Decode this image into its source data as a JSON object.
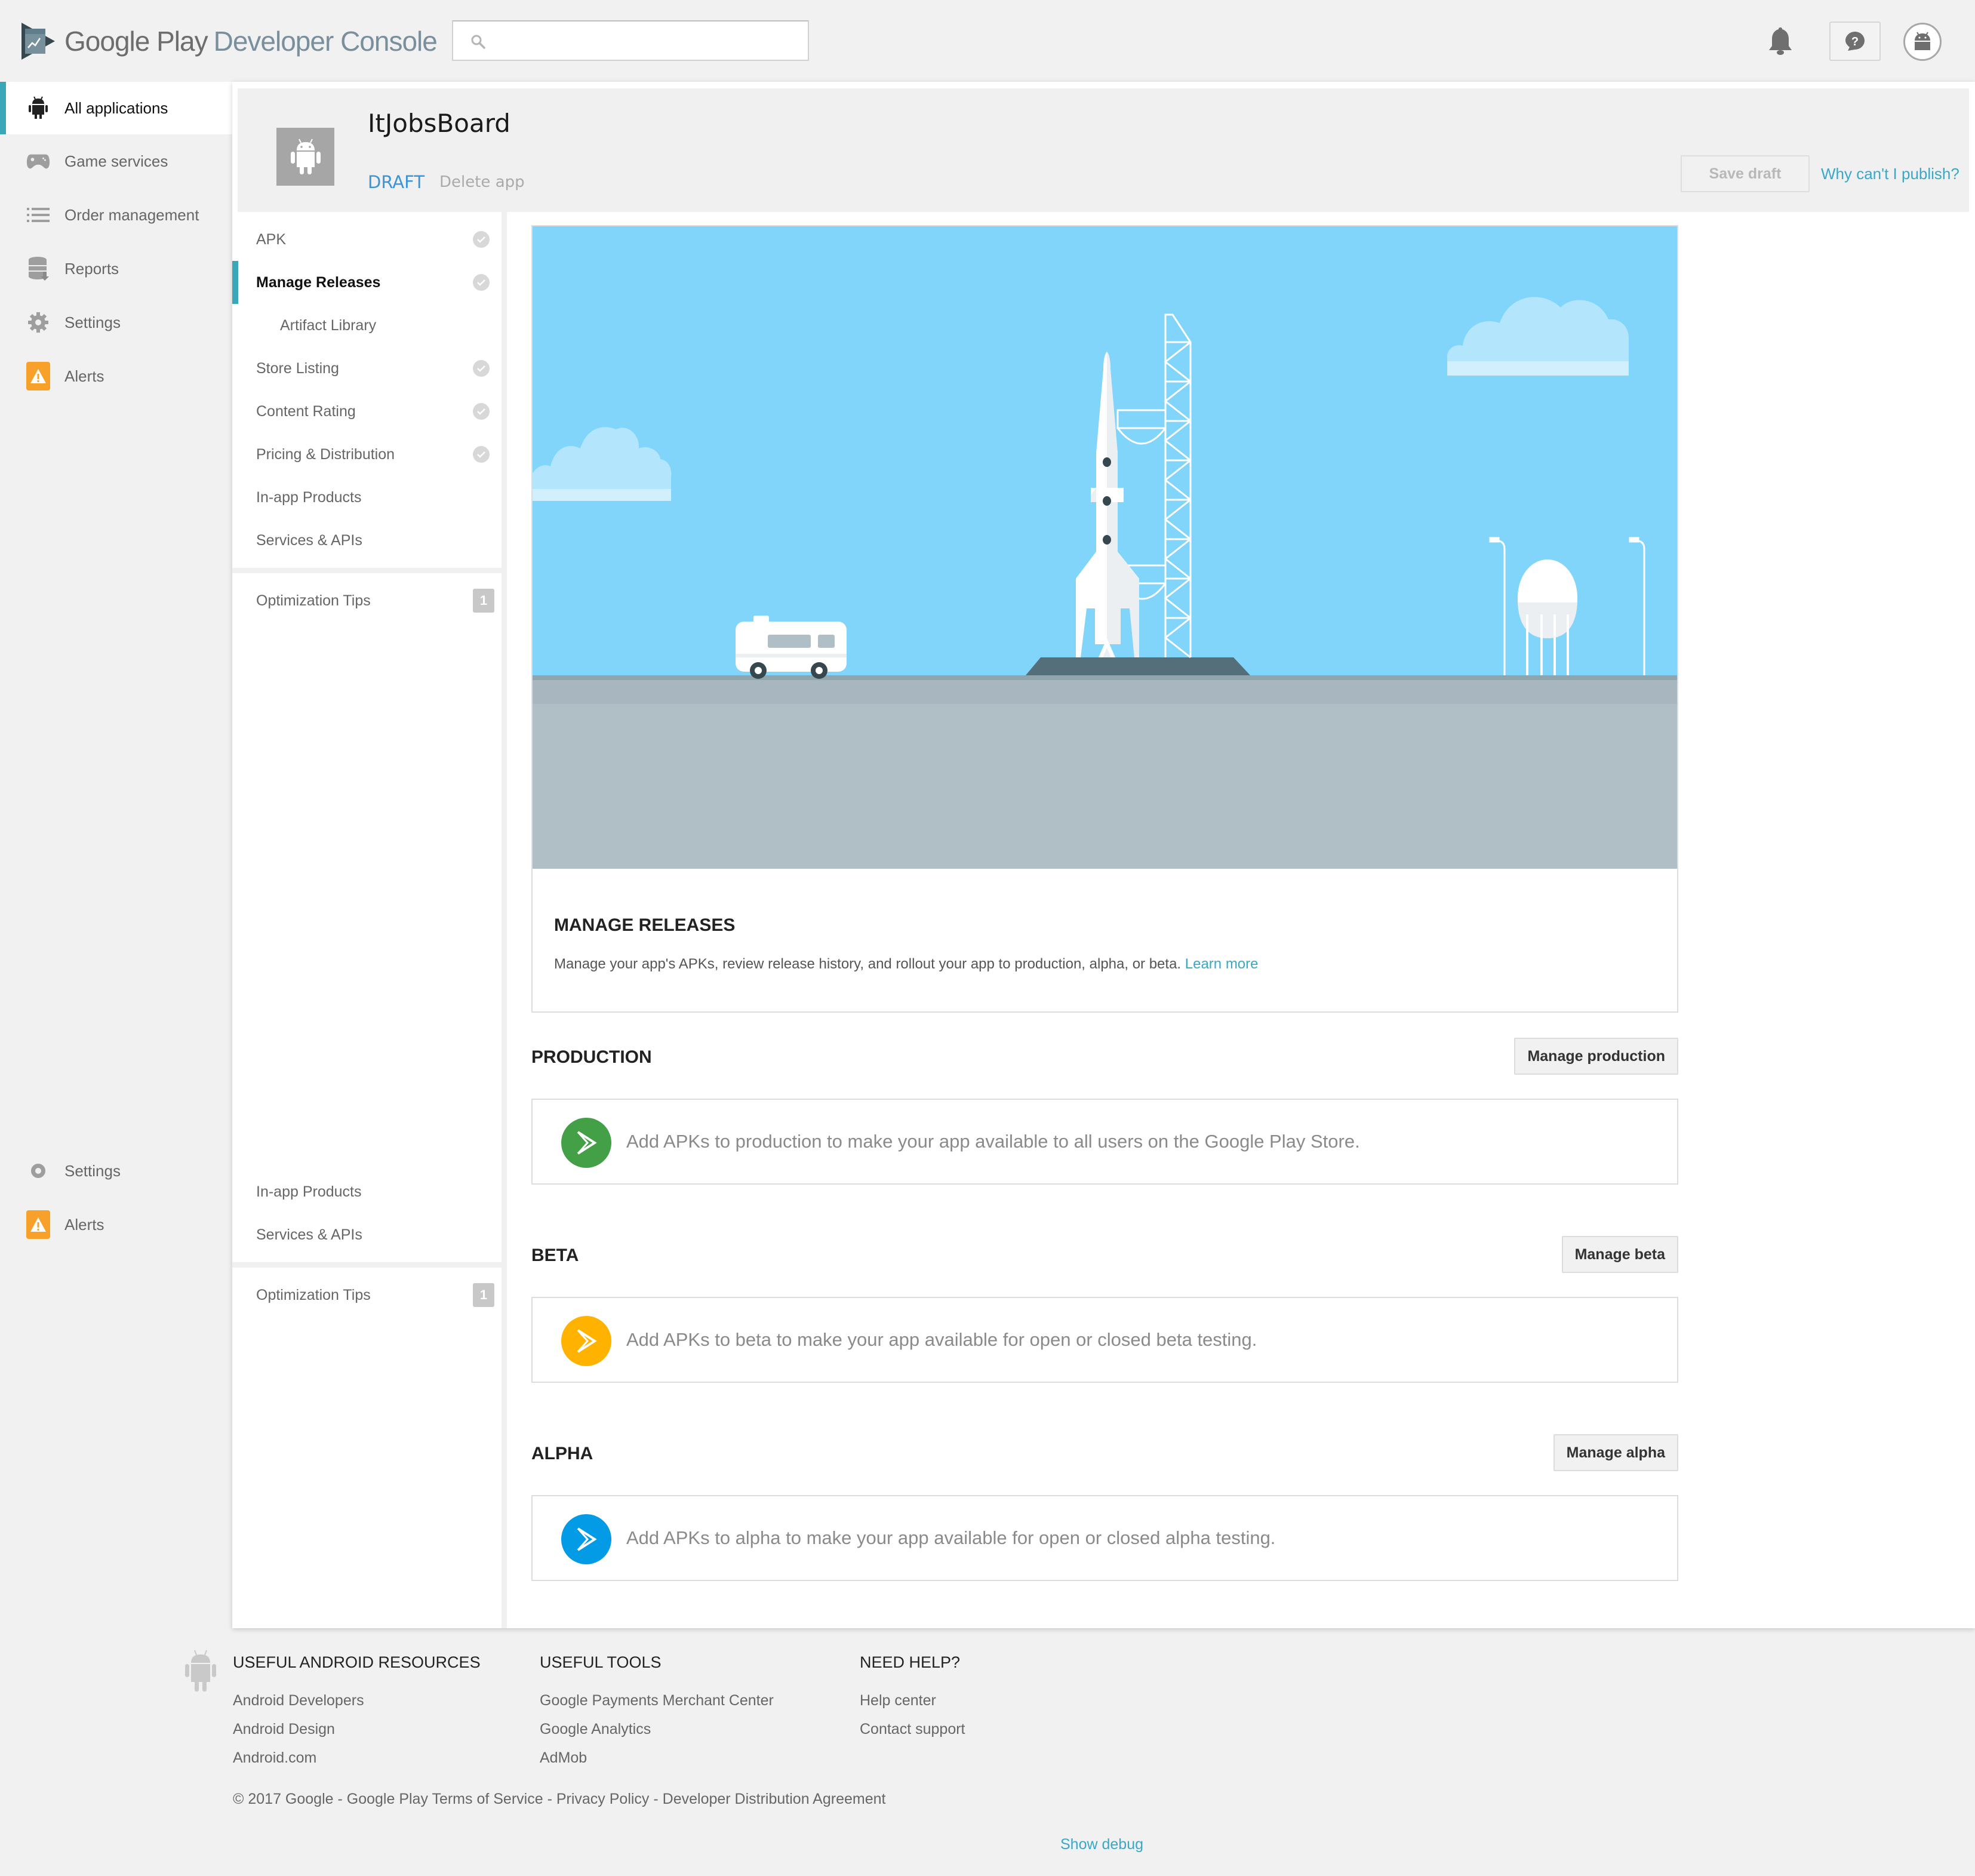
{
  "topbar": {
    "brand_primary": "Google Play",
    "brand_secondary": "Developer Console",
    "search_placeholder": "",
    "search_value": "",
    "icons": [
      "bell-icon",
      "help-icon",
      "android-avatar-icon"
    ]
  },
  "leftnav": {
    "items": [
      {
        "label": "All applications",
        "icon": "android-icon",
        "active": true
      },
      {
        "label": "Game services",
        "icon": "gamepad-icon"
      },
      {
        "label": "Order management",
        "icon": "list-icon"
      },
      {
        "label": "Reports",
        "icon": "database-download-icon"
      },
      {
        "label": "Settings",
        "icon": "gear-icon"
      },
      {
        "label": "Alerts",
        "icon": "warning-icon"
      }
    ]
  },
  "app": {
    "name": "ItJobsBoard",
    "status": "DRAFT",
    "delete_label": "Delete app",
    "save_draft_label": "Save draft",
    "why_publish_label": "Why can't I publish?"
  },
  "subnav": {
    "items": [
      {
        "label": "APK",
        "checked": true
      },
      {
        "label": "Manage Releases",
        "checked": true,
        "active": true
      },
      {
        "label": "Artifact Library",
        "child": true
      },
      {
        "label": "Store Listing",
        "checked": true
      },
      {
        "label": "Content Rating",
        "checked": true
      },
      {
        "label": "Pricing & Distribution",
        "checked": true
      },
      {
        "label": "In-app Products"
      },
      {
        "label": "Services & APIs"
      }
    ],
    "optimization": {
      "label": "Optimization Tips",
      "badge": "1"
    }
  },
  "colors": {
    "accent": "#3aa7b9",
    "link": "#3aa7c7",
    "draft": "#3b94d9",
    "alert": "#f7a02a",
    "production": "#43a047",
    "beta": "#ffb300",
    "alpha": "#039be5",
    "sky": "#81d4fa",
    "ground": "#b0bec5"
  },
  "manage_releases": {
    "title": "MANAGE RELEASES",
    "description": "Manage your app's APKs, review release history, and rollout your app to production, alpha, or beta.",
    "learn_more": "Learn more"
  },
  "tracks": [
    {
      "title": "PRODUCTION",
      "button": "Manage production",
      "message": "Add APKs to production to make your app available to all users on the Google Play Store.",
      "color": "#43a047"
    },
    {
      "title": "BETA",
      "button": "Manage beta",
      "message": "Add APKs to beta to make your app available for open or closed beta testing.",
      "color": "#ffb300"
    },
    {
      "title": "ALPHA",
      "button": "Manage alpha",
      "message": "Add APKs to alpha to make your app available for open or closed alpha testing.",
      "color": "#039be5"
    }
  ],
  "footer": {
    "columns": [
      {
        "heading": "USEFUL ANDROID RESOURCES",
        "links": [
          "Android Developers",
          "Android Design",
          "Android.com"
        ]
      },
      {
        "heading": "USEFUL TOOLS",
        "links": [
          "Google Payments Merchant Center",
          "Google Analytics",
          "AdMob"
        ]
      },
      {
        "heading": "NEED HELP?",
        "links": [
          "Help center",
          "Contact support"
        ]
      }
    ],
    "copyright": "© 2017 Google",
    "legal_links": [
      "Google Play Terms of Service",
      "Privacy Policy",
      "Developer Distribution Agreement"
    ],
    "separator": " - ",
    "show_debug": "Show debug"
  }
}
